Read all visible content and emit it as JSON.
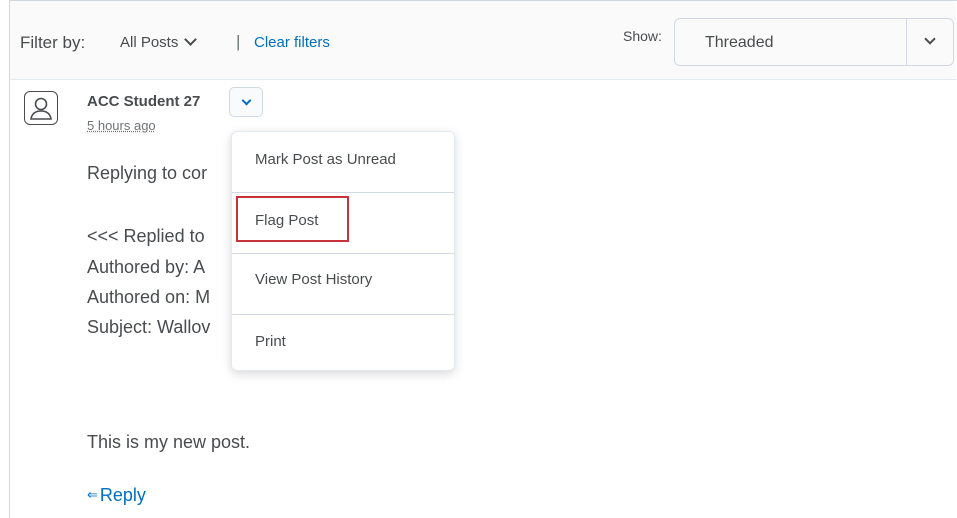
{
  "filter_bar": {
    "label": "Filter by:",
    "filter_value": "All Posts",
    "separator": "|",
    "clear_filters": "Clear filters",
    "show_label": "Show:",
    "show_value": "Threaded"
  },
  "post": {
    "author": "ACC Student 27",
    "timestamp": "5 hours ago",
    "lines": [
      "Replying to cor",
      "<<< Replied to",
      "Authored by: A",
      "Authored on: M",
      "Subject: Wallov"
    ],
    "body": "This is my new post.",
    "reply_label": "Reply"
  },
  "menu": {
    "items": [
      {
        "label": "Mark Post as Unread"
      },
      {
        "label": "Flag Post"
      },
      {
        "label": "View Post History"
      },
      {
        "label": "Print"
      }
    ]
  },
  "colors": {
    "link": "#006fbf",
    "highlight": "#c8333a",
    "text": "#494c4e"
  },
  "icons": {
    "avatar": "user-avatar-icon",
    "reply": "reply-arrows-icon",
    "chevron": "chevron-down-icon"
  }
}
